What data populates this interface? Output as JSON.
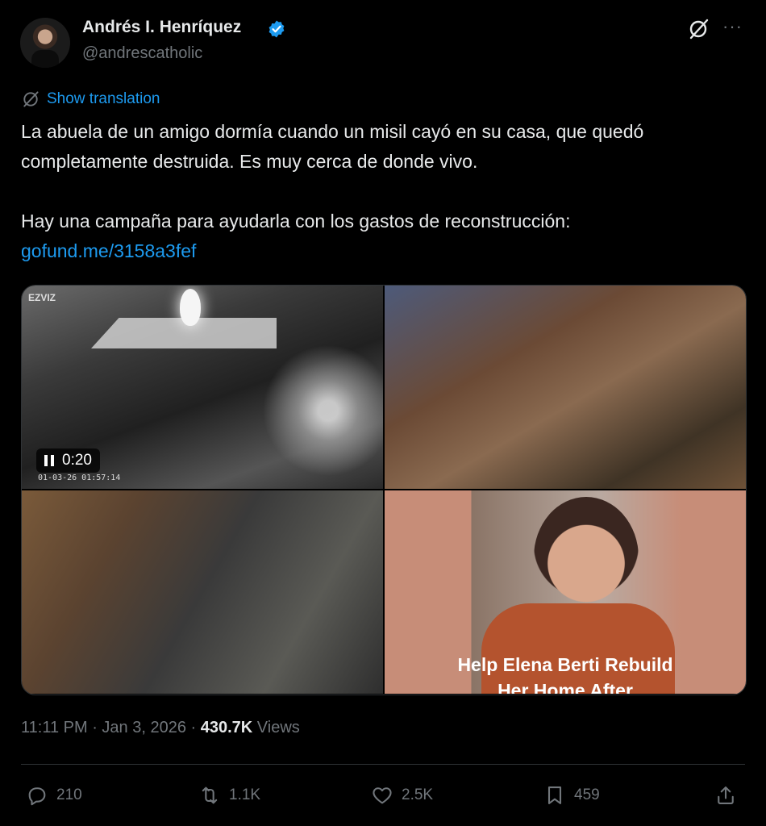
{
  "author": {
    "name": "Andrés I. Henríquez",
    "handle": "@andrescatholic",
    "verified": true
  },
  "translate_label": "Show translation",
  "tweet": {
    "line1": "La abuela de un amigo dormía cuando un misil cayó en su casa, que quedó completamente destruida. Es muy cerca de donde vivo.",
    "line2": "Hay una campaña para ayudarla con los gastos de reconstrucción:",
    "link": "gofund.me/3158a3fef"
  },
  "media": {
    "video_brand": "EZVIZ",
    "video_time": "0:20",
    "video_timestamp": "01-03-26 01:57:14",
    "fundraiser_caption_1": "Help Elena Berti Rebuild",
    "fundraiser_caption_2": "Her Home After"
  },
  "meta": {
    "time": "11:11 PM",
    "date": "Jan 3, 2026",
    "views_count": "430.7K",
    "views_label": "Views"
  },
  "actions": {
    "replies": "210",
    "reposts": "1.1K",
    "likes": "2.5K",
    "bookmarks": "459"
  },
  "colors": {
    "accent": "#1d9bf0",
    "muted": "#71767b",
    "text": "#e7e9ea",
    "background": "#000000"
  }
}
